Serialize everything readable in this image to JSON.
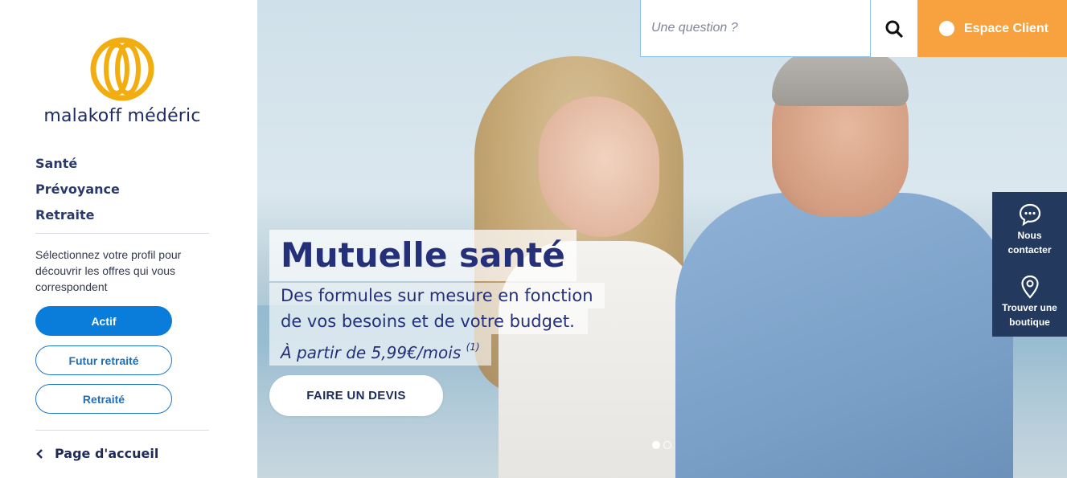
{
  "brand": {
    "name": "malakoff médéric",
    "logo_icon": "intertwined-rings-logo",
    "logo_color": "#f2ad11"
  },
  "sidebar": {
    "nav": [
      {
        "label": "Santé"
      },
      {
        "label": "Prévoyance"
      },
      {
        "label": "Retraite"
      }
    ],
    "profile_prompt": "Sélectionnez votre profil pour découvrir les offres qui vous correspondent",
    "profiles": [
      {
        "label": "Actif",
        "selected": true
      },
      {
        "label": "Futur retraité",
        "selected": false
      },
      {
        "label": "Retraité",
        "selected": false
      }
    ],
    "back_link": {
      "label": "Page d'accueil",
      "icon": "chevron-left-icon"
    }
  },
  "header": {
    "search": {
      "placeholder": "Une question ?",
      "value": "",
      "icon": "search-icon"
    },
    "client_button": {
      "label": "Espace Client",
      "color": "#f7a23e"
    }
  },
  "hero": {
    "title": "Mutuelle santé",
    "subtitle_lines": [
      "Des formules sur mesure en fonction",
      "de vos besoins et de votre budget."
    ],
    "price": "À partir de 5,99€/mois",
    "price_note": "(1)",
    "cta": "FAIRE UN DEVIS",
    "carousel": {
      "slides": 2,
      "active": 1
    }
  },
  "side_panel": {
    "items": [
      {
        "label_lines": [
          "Nous",
          "contacter"
        ],
        "icon": "chat-bubble-icon"
      },
      {
        "label_lines": [
          "Trouver une",
          "boutique"
        ],
        "icon": "map-pin-icon"
      }
    ],
    "color": "#233a5e"
  },
  "colors": {
    "primary_blue": "#0a7ddb",
    "navy": "#1e2b5a",
    "accent_orange": "#f7a23e"
  }
}
